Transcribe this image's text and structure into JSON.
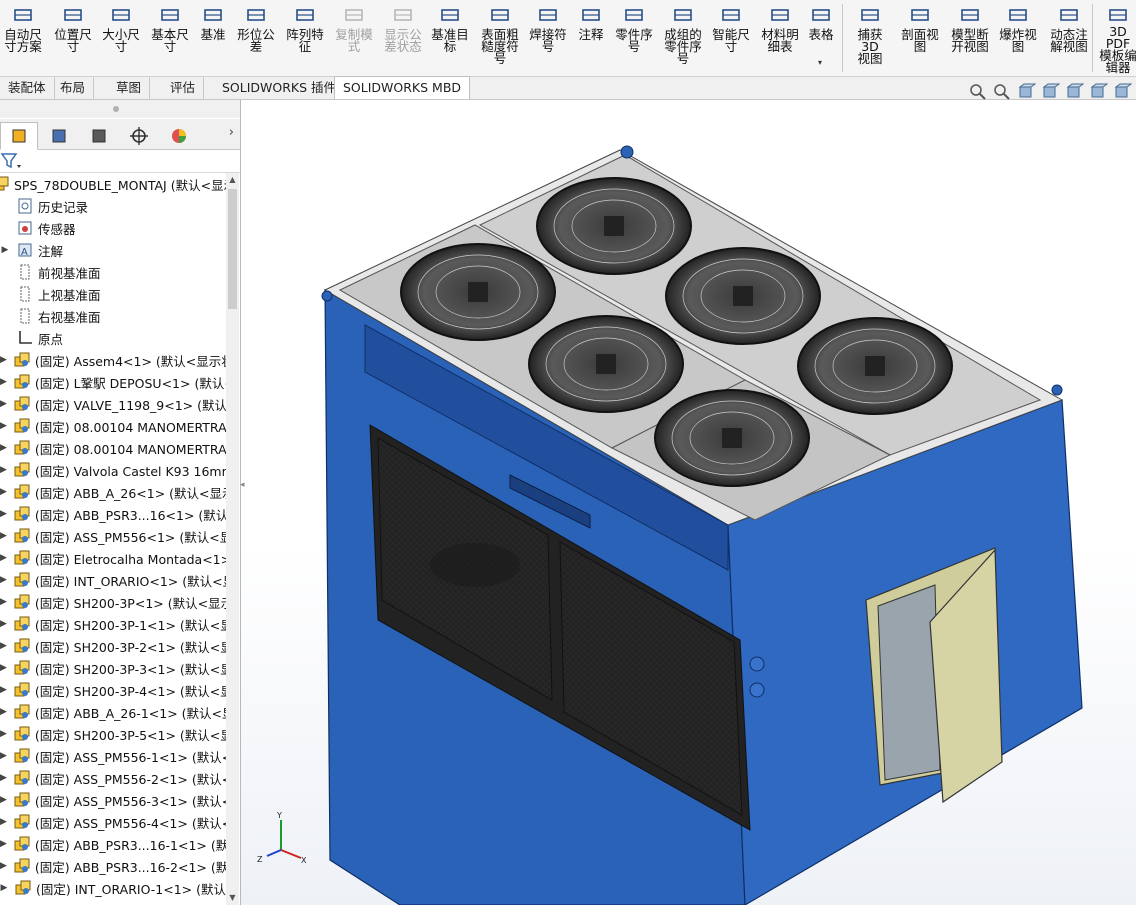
{
  "ribbon": {
    "buttons": [
      {
        "label": "自动尺\n寸方案",
        "icon": "auto-dimension-icon",
        "disabled": false
      },
      {
        "label": "位置尺\n寸",
        "icon": "location-dimension-icon",
        "disabled": false
      },
      {
        "label": "大小尺\n寸",
        "icon": "size-dimension-icon",
        "disabled": false
      },
      {
        "label": "基本尺\n寸",
        "icon": "basic-dimension-icon",
        "disabled": false
      },
      {
        "label": "基准",
        "icon": "datum-icon",
        "disabled": false
      },
      {
        "label": "形位公\n差",
        "icon": "geometric-tolerance-icon",
        "disabled": false
      },
      {
        "label": "阵列特\n征",
        "icon": "pattern-feature-icon",
        "disabled": false
      },
      {
        "label": "复制模\n式",
        "icon": "copy-scheme-icon",
        "disabled": true
      },
      {
        "label": "显示公\n差状态",
        "icon": "tolerance-status-icon",
        "disabled": true
      },
      {
        "label": "基准目\n标",
        "icon": "datum-target-icon",
        "disabled": false
      },
      {
        "label": "表面粗\n糙度符\n号",
        "icon": "surface-finish-icon",
        "disabled": false
      },
      {
        "label": "焊接符\n号",
        "icon": "weld-symbol-icon",
        "disabled": false
      },
      {
        "label": "注释",
        "icon": "note-icon",
        "disabled": false
      },
      {
        "label": "零件序\n号",
        "icon": "balloon-icon",
        "disabled": false
      },
      {
        "label": "成组的\n零件序\n号",
        "icon": "stacked-balloon-icon",
        "disabled": false
      },
      {
        "label": "智能尺\n寸",
        "icon": "smart-dimension-icon",
        "disabled": false
      },
      {
        "label": "材料明\n细表",
        "icon": "bom-icon",
        "disabled": false
      },
      {
        "label": "表格",
        "icon": "table-icon",
        "disabled": false
      },
      {
        "label": "捕获 3D\n视图",
        "icon": "capture-3d-view-icon",
        "disabled": false
      },
      {
        "label": "剖面视\n图",
        "icon": "section-view-icon",
        "disabled": false
      },
      {
        "label": "模型断\n开视图",
        "icon": "break-view-icon",
        "disabled": false
      },
      {
        "label": "爆炸视\n图",
        "icon": "exploded-view-icon",
        "disabled": false
      },
      {
        "label": "动态注\n解视图",
        "icon": "dynamic-annotation-icon",
        "disabled": false
      },
      {
        "label": "3D PDF\n模板编\n辑器",
        "icon": "pdf-template-icon",
        "disabled": false
      }
    ]
  },
  "tabs": [
    {
      "label": "装配体",
      "active": false
    },
    {
      "label": "布局",
      "active": false
    },
    {
      "label": "草图",
      "active": false
    },
    {
      "label": "评估",
      "active": false
    },
    {
      "label": "SOLIDWORKS 插件",
      "active": false
    },
    {
      "label": "SOLIDWORKS MBD",
      "active": true
    }
  ],
  "view_tools": [
    "zoom-to-fit-icon",
    "zoom-area-icon",
    "previous-view-icon",
    "section-view-icon",
    "view-orientation-icon",
    "display-style-icon",
    "hide-show-icon"
  ],
  "panel": {
    "tabs": [
      "featuremanager-icon",
      "propertymanager-icon",
      "configurationmanager-icon",
      "dimxpert-icon",
      "appearance-icon"
    ],
    "filter_icon": "filter-icon",
    "tree": [
      {
        "label": "SPS_78DOUBLE_MONTAJ  (默认<显示",
        "kind": "root",
        "expander": false
      },
      {
        "label": "历史记录",
        "kind": "history",
        "expander": false
      },
      {
        "label": "传感器",
        "kind": "sensor",
        "expander": false
      },
      {
        "label": "注解",
        "kind": "annotation",
        "expander": true
      },
      {
        "label": "前视基准面",
        "kind": "plane",
        "expander": false
      },
      {
        "label": "上视基准面",
        "kind": "plane",
        "expander": false
      },
      {
        "label": "右视基准面",
        "kind": "plane",
        "expander": false
      },
      {
        "label": "原点",
        "kind": "origin",
        "expander": false
      },
      {
        "label": "(固定) Assem4<1> (默认<显示状",
        "kind": "assembly",
        "expander": true
      },
      {
        "label": "(固定) L鞏駅 DEPOSU<1> (默认<",
        "kind": "assembly",
        "expander": true
      },
      {
        "label": "(固定) VALVE_1198_9<1> (默认<",
        "kind": "assembly",
        "expander": true
      },
      {
        "label": "(固定) 08.00104 MANOMERTRA",
        "kind": "assembly",
        "expander": true
      },
      {
        "label": "(固定) 08.00104 MANOMERTRA",
        "kind": "assembly",
        "expander": true
      },
      {
        "label": "(固定) Valvola Castel  K93 16mm",
        "kind": "assembly",
        "expander": true
      },
      {
        "label": "(固定) ABB_A_26<1> (默认<显示",
        "kind": "assembly",
        "expander": true
      },
      {
        "label": "(固定) ABB_PSR3...16<1> (默认<",
        "kind": "assembly",
        "expander": true
      },
      {
        "label": "(固定) ASS_PM556<1> (默认<显",
        "kind": "assembly",
        "expander": true
      },
      {
        "label": "(固定) Eletrocalha Montada<1>",
        "kind": "assembly",
        "expander": true
      },
      {
        "label": "(固定) INT_ORARIO<1> (默认<显",
        "kind": "assembly",
        "expander": true
      },
      {
        "label": "(固定) SH200-3P<1> (默认<显示",
        "kind": "assembly",
        "expander": true
      },
      {
        "label": "(固定) SH200-3P-1<1> (默认<显",
        "kind": "assembly",
        "expander": true
      },
      {
        "label": "(固定) SH200-3P-2<1> (默认<显",
        "kind": "assembly",
        "expander": true
      },
      {
        "label": "(固定) SH200-3P-3<1> (默认<显",
        "kind": "assembly",
        "expander": true
      },
      {
        "label": "(固定) SH200-3P-4<1> (默认<显",
        "kind": "assembly",
        "expander": true
      },
      {
        "label": "(固定) ABB_A_26-1<1> (默认<显",
        "kind": "assembly",
        "expander": true
      },
      {
        "label": "(固定) SH200-3P-5<1> (默认<显",
        "kind": "assembly",
        "expander": true
      },
      {
        "label": "(固定) ASS_PM556-1<1> (默认<",
        "kind": "assembly",
        "expander": true
      },
      {
        "label": "(固定) ASS_PM556-2<1> (默认<",
        "kind": "assembly",
        "expander": true
      },
      {
        "label": "(固定) ASS_PM556-3<1> (默认<",
        "kind": "assembly",
        "expander": true
      },
      {
        "label": "(固定) ASS_PM556-4<1> (默认<",
        "kind": "assembly",
        "expander": true
      },
      {
        "label": "(固定) ABB_PSR3...16-1<1> (默认",
        "kind": "assembly",
        "expander": true
      },
      {
        "label": "(固定) ABB_PSR3...16-2<1> (默认",
        "kind": "assembly",
        "expander": true
      },
      {
        "label": "(固定) INT_ORARIO-1<1> (默认",
        "kind": "assembly",
        "expander": true
      }
    ]
  },
  "triad": {
    "x": "X",
    "y": "Y",
    "z": "Z"
  },
  "colors": {
    "housing": "#2a62b8",
    "housing_dark": "#1c4892",
    "panel_door": "#cfcd9c",
    "fan_plate": "#c8c8c8",
    "accent_active_tab": "#ffffff"
  }
}
